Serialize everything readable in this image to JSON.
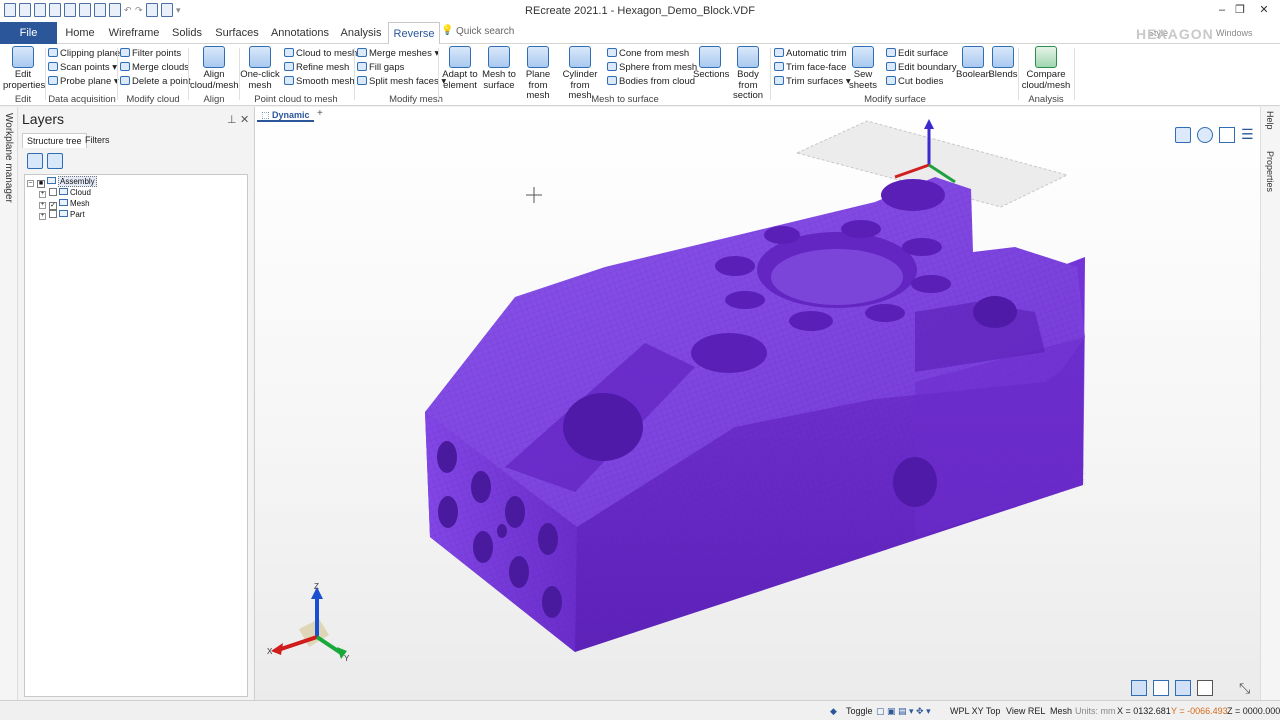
{
  "window": {
    "title": "REcreate 2021.1 - Hexagon_Demo_Block.VDF",
    "brand": "HEXAGON",
    "minimize": "–",
    "restore": "❐",
    "close": "✕"
  },
  "menu": {
    "file": "File",
    "tabs": [
      "Home",
      "Wireframe",
      "Solids",
      "Surfaces",
      "Annotations",
      "Analysis",
      "Reverse"
    ],
    "active_tab": "Reverse",
    "quick_search_placeholder": "Quick search",
    "style": "Style",
    "windows": "Windows"
  },
  "ribbon": {
    "groups": {
      "edit": "Edit",
      "data_acquisition": "Data acquisition",
      "modify_cloud": "Modify cloud",
      "align": "Align",
      "point_cloud_to_mesh": "Point cloud to mesh",
      "modify_mesh": "Modify mesh",
      "mesh_to_surface": "Mesh to surface",
      "modify_surface": "Modify surface",
      "analysis": "Analysis"
    },
    "edit_properties": [
      "Edit",
      "properties"
    ],
    "clipping_plane": "Clipping plane",
    "scan_points": "Scan points",
    "probe_plane": "Probe plane",
    "filter_points": "Filter points",
    "merge_clouds": "Merge clouds",
    "delete_a_point": "Delete a point",
    "align_cloud_mesh": [
      "Align",
      "cloud/mesh"
    ],
    "one_click_mesh": [
      "One-click",
      "mesh"
    ],
    "cloud_to_mesh": "Cloud to mesh",
    "refine_mesh": "Refine mesh",
    "smooth_mesh": "Smooth mesh",
    "merge_meshes": "Merge meshes",
    "fill_gaps": "Fill gaps",
    "split_mesh_faces": "Split mesh faces",
    "adapt_to_element": [
      "Adapt to",
      "element"
    ],
    "mesh_to_surface": [
      "Mesh to",
      "surface"
    ],
    "plane_from_mesh": [
      "Plane",
      "from mesh"
    ],
    "cylinder_from_mesh": [
      "Cylinder",
      "from mesh"
    ],
    "cone_from_mesh": "Cone from mesh",
    "sphere_from_mesh": "Sphere from mesh",
    "bodies_from_cloud": "Bodies from cloud",
    "sections": "Sections",
    "body_from_section": [
      "Body from",
      "section"
    ],
    "automatic_trim": "Automatic trim",
    "trim_face_face": "Trim face-face",
    "trim_surfaces": "Trim surfaces",
    "sew_sheets": [
      "Sew",
      "sheets"
    ],
    "edit_surface": "Edit surface",
    "edit_boundary": "Edit boundary",
    "cut_bodies": "Cut bodies",
    "boolean": "Boolean",
    "blends": "Blends",
    "compare_cloud_mesh": [
      "Compare",
      "cloud/mesh"
    ]
  },
  "left_strip": {
    "label": "Workplane manager"
  },
  "layers": {
    "title": "Layers",
    "pin": "⊥",
    "close": "✕",
    "tabs": [
      "Structure tree",
      "Filters"
    ],
    "active_tab": "Structure tree",
    "tree": [
      {
        "label": "Assembly",
        "level": 0,
        "checked": "partial",
        "selected": true
      },
      {
        "label": "Cloud",
        "level": 1,
        "checked": false
      },
      {
        "label": "Mesh",
        "level": 1,
        "checked": true
      },
      {
        "label": "Part",
        "level": 1,
        "checked": false
      }
    ]
  },
  "viewport": {
    "tab": "Dynamic",
    "add_tab": "+",
    "triad": {
      "x": "X",
      "y": "Y",
      "z": "Z"
    },
    "model_color": "#7b3fe0"
  },
  "right_strip": {
    "help": "Help",
    "properties": "Properties"
  },
  "status": {
    "toggle": "Toggle",
    "wpl": "WPL XY Top",
    "view": "View REL",
    "mode": "Mesh",
    "units": "Units: mm",
    "x": "X = 0132.681",
    "y": "Y = -0066.493",
    "z": "Z = 0000.000"
  }
}
